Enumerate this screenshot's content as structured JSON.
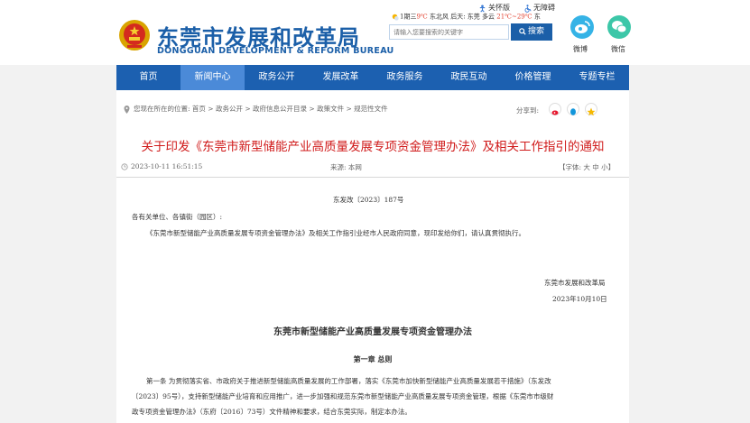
{
  "header": {
    "logo_cn": "东莞市发展和改革局",
    "logo_en": "DONGGUAN DEVELOPMENT & REFORM BUREAU",
    "elder_link": "关怀版",
    "accessible_link": "无障碍",
    "weather_a": "1期三",
    "weather_temp1": "9℃",
    "weather_b": " 东北风 后天: 东莞 多云 ",
    "weather_range": "21℃~29℃",
    "weather_c": " 东",
    "search_placeholder": "请输入您要搜索的关键字",
    "search_button": "搜索",
    "weibo_label": "微博",
    "wechat_label": "微信"
  },
  "nav": [
    {
      "label": "首页"
    },
    {
      "label": "新闻中心"
    },
    {
      "label": "政务公开"
    },
    {
      "label": "发展改革"
    },
    {
      "label": "政务服务"
    },
    {
      "label": "政民互动"
    },
    {
      "label": "价格管理"
    },
    {
      "label": "专题专栏"
    }
  ],
  "breadcrumb": "您现在所在的位置:  首页 > 政务公开 > 政府信息公开目录 > 政策文件 > 规范性文件",
  "share_label": "分享到:",
  "article": {
    "title": "关于印发《东莞市新型储能产业高质量发展专项资金管理办法》及相关工作指引的通知",
    "date": "2023-10-11 16:51:15",
    "source": "来源:  本网",
    "font_size": "【字体:  大  中  小】",
    "doc_number": "东发改〔2023〕187号",
    "salutation": "各有关单位、各镇街（园区）:",
    "body_p1": "《东莞市新型储能产业高质量发展专项资金管理办法》及相关工作指引业经市人民政府同意，现印发给你们，请认真贯彻执行。",
    "signature": "东莞市发展和改革局",
    "sign_date": "2023年10月10日",
    "doc_title": "东莞市新型储能产业高质量发展专项资金管理办法",
    "chapter": "第一章  总则",
    "art1_l1": "第一条  为贯彻落实省、市政府关于推进新型储能高质量发展的工作部署，落实《东莞市加快新型储能产业高质量发展若干措施》（东发改",
    "art1_l2": "〔2023〕95号），支持新型储能产业培育和应用推广，进一步加强和规范东莞市新型储能产业高质量发展专项资金管理，根据《东莞市市级财",
    "art1_l3": "政专项资金管理办法》（东府〔2016〕73号）文件精神和要求，结合东莞实际，制定本办法。"
  },
  "colors": {
    "brand_blue": "#1b5fa8",
    "nav_blue": "#1c60b0",
    "nav_active": "#4b8ad8",
    "title_red": "#d01b1b"
  }
}
